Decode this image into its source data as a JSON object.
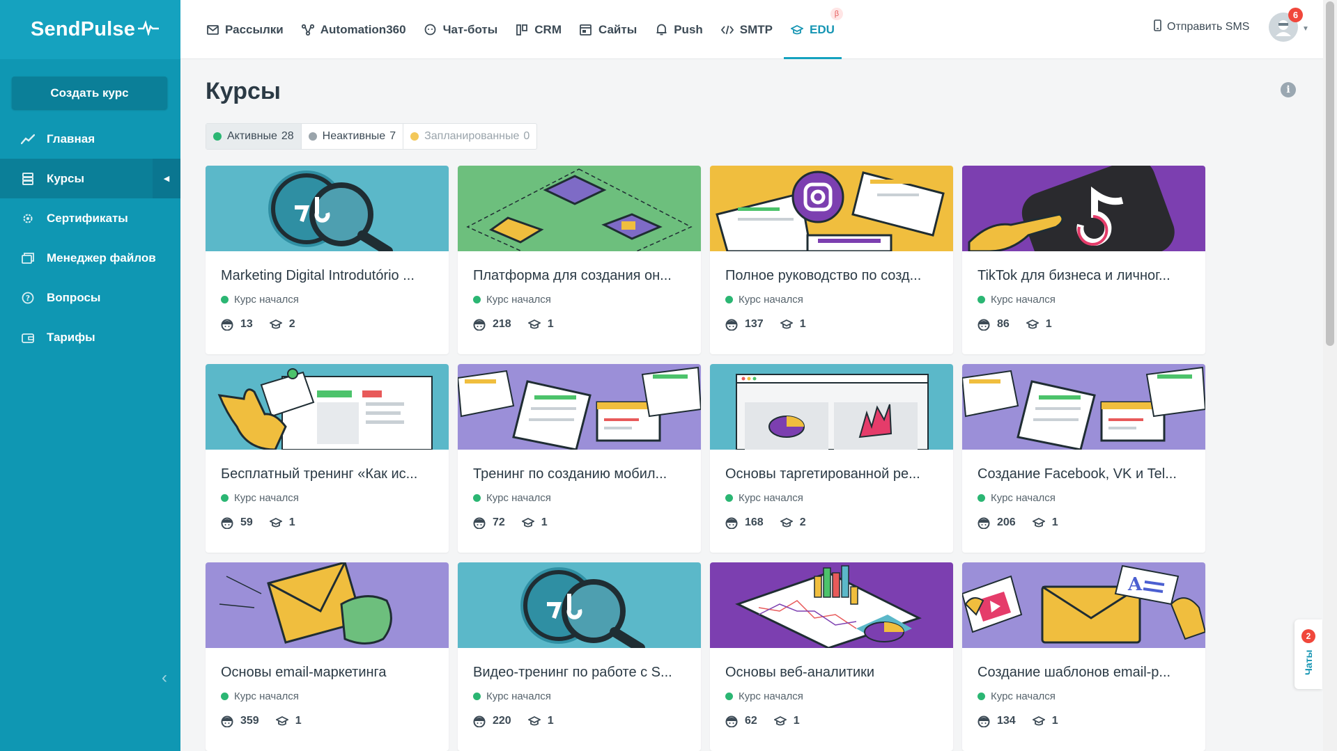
{
  "sidebar": {
    "logo": "SendPulse",
    "create_button": "Создать курс",
    "items": [
      {
        "label": "Главная",
        "icon": "chart-line-icon"
      },
      {
        "label": "Курсы",
        "icon": "layers-icon"
      },
      {
        "label": "Сертификаты",
        "icon": "gear-icon"
      },
      {
        "label": "Менеджер файлов",
        "icon": "folder-icon"
      },
      {
        "label": "Вопросы",
        "icon": "question-icon"
      },
      {
        "label": "Тарифы",
        "icon": "wallet-icon"
      }
    ]
  },
  "topnav": {
    "items": [
      {
        "label": "Рассылки",
        "icon": "mail-icon"
      },
      {
        "label": "Automation360",
        "icon": "automation-icon"
      },
      {
        "label": "Чат-боты",
        "icon": "chatbot-icon"
      },
      {
        "label": "CRM",
        "icon": "crm-icon"
      },
      {
        "label": "Сайты",
        "icon": "sites-icon"
      },
      {
        "label": "Push",
        "icon": "bell-icon"
      },
      {
        "label": "SMTP",
        "icon": "code-icon"
      },
      {
        "label": "EDU",
        "icon": "graduation-cap-icon"
      }
    ],
    "beta": "β",
    "send_sms": "Отправить SMS",
    "avatar_badge": "6"
  },
  "page": {
    "title": "Курсы",
    "info": "i"
  },
  "filters": [
    {
      "label": "Активные",
      "count": "28",
      "color": "#2bb673"
    },
    {
      "label": "Неактивные",
      "count": "7",
      "color": "#9aa4ab"
    },
    {
      "label": "Запланированные",
      "count": "0",
      "color": "#f3c85a"
    }
  ],
  "courses": [
    {
      "title": "Marketing Digital Introdutório ...",
      "status": "Курс начался",
      "students": "13",
      "lessons": "2",
      "theme": "magnifier"
    },
    {
      "title": "Платформа для создания он...",
      "status": "Курс начался",
      "students": "218",
      "lessons": "1",
      "theme": "iso"
    },
    {
      "title": "Полное руководство по созд...",
      "status": "Курс начался",
      "students": "137",
      "lessons": "1",
      "theme": "insta"
    },
    {
      "title": "TikTok для бизнеса и личног...",
      "status": "Курс начался",
      "students": "86",
      "lessons": "1",
      "theme": "tiktok"
    },
    {
      "title": "Бесплатный тренинг «Как ис...",
      "status": "Курс начался",
      "students": "59",
      "lessons": "1",
      "theme": "hand"
    },
    {
      "title": "Тренинг по созданию мобил...",
      "status": "Курс начался",
      "students": "72",
      "lessons": "1",
      "theme": "forms"
    },
    {
      "title": "Основы таргетированной ре...",
      "status": "Курс начался",
      "students": "168",
      "lessons": "2",
      "theme": "charts"
    },
    {
      "title": "Создание Facebook, VK и Tel...",
      "status": "Курс начался",
      "students": "206",
      "lessons": "1",
      "theme": "forms"
    },
    {
      "title": "Основы email-маркетинга",
      "status": "Курс начался",
      "students": "359",
      "lessons": "1",
      "theme": "email"
    },
    {
      "title": "Видео-тренинг по работе с S...",
      "status": "Курс начался",
      "students": "220",
      "lessons": "1",
      "theme": "magnifier"
    },
    {
      "title": "Основы веб-аналитики",
      "status": "Курс начался",
      "students": "62",
      "lessons": "1",
      "theme": "analytics"
    },
    {
      "title": "Создание шаблонов email-р...",
      "status": "Курс начался",
      "students": "134",
      "lessons": "1",
      "theme": "template"
    }
  ],
  "chats": {
    "label": "Чаты",
    "badge": "2"
  },
  "colors": {
    "sidebar": "#0f97b3",
    "accent": "#15a2bf",
    "teal_thumb": "#5bb8c9",
    "green_thumb": "#6dbf7d",
    "yellow_thumb": "#f0be3e",
    "purple_thumb": "#7c3fb0",
    "lilac_thumb": "#9b8fd8"
  }
}
